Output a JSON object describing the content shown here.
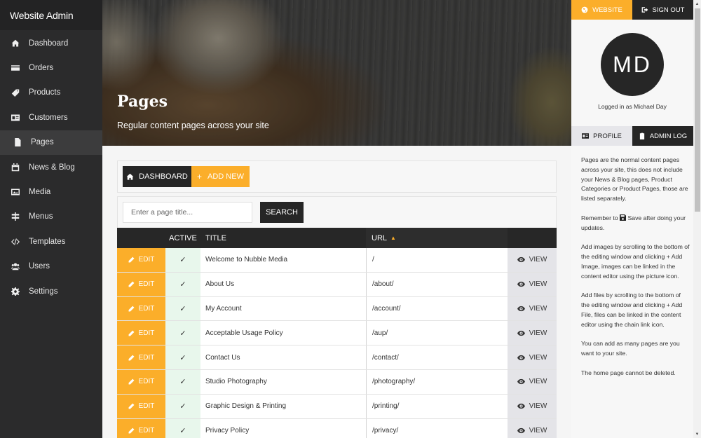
{
  "app": {
    "title": "Website Admin"
  },
  "sidebar": {
    "items": [
      {
        "label": "Dashboard",
        "icon": "home-icon",
        "active": false
      },
      {
        "label": "Orders",
        "icon": "credit-card-icon",
        "active": false
      },
      {
        "label": "Products",
        "icon": "tag-icon",
        "active": false
      },
      {
        "label": "Customers",
        "icon": "id-card-icon",
        "active": false
      },
      {
        "label": "Pages",
        "icon": "file-icon",
        "active": true
      },
      {
        "label": "News & Blog",
        "icon": "calendar-icon",
        "active": false
      },
      {
        "label": "Media",
        "icon": "image-icon",
        "active": false
      },
      {
        "label": "Menus",
        "icon": "signpost-icon",
        "active": false
      },
      {
        "label": "Templates",
        "icon": "code-icon",
        "active": false
      },
      {
        "label": "Users",
        "icon": "users-icon",
        "active": false
      },
      {
        "label": "Settings",
        "icon": "gear-icon",
        "active": false
      }
    ]
  },
  "hero": {
    "title": "Pages",
    "subtitle": "Regular content pages across your site"
  },
  "toolbar": {
    "dashboard_label": "DASHBOARD",
    "add_new_label": "ADD NEW"
  },
  "search": {
    "placeholder": "Enter a page title...",
    "value": "",
    "button_label": "SEARCH"
  },
  "table": {
    "columns": {
      "edit": "",
      "active": "ACTIVE",
      "title": "TITLE",
      "url": "URL",
      "view": ""
    },
    "sort": {
      "column": "url",
      "direction": "asc",
      "icon": "sort-up-icon"
    },
    "edit_label": "EDIT",
    "view_label": "VIEW",
    "active_mark": "✓",
    "rows": [
      {
        "active": true,
        "title": "Welcome to Nubble Media",
        "url": "/"
      },
      {
        "active": true,
        "title": "About Us",
        "url": "/about/"
      },
      {
        "active": true,
        "title": "My Account",
        "url": "/account/"
      },
      {
        "active": true,
        "title": "Acceptable Usage Policy",
        "url": "/aup/"
      },
      {
        "active": true,
        "title": "Contact Us",
        "url": "/contact/"
      },
      {
        "active": true,
        "title": "Studio Photography",
        "url": "/photography/"
      },
      {
        "active": true,
        "title": "Graphic Design & Printing",
        "url": "/printing/"
      },
      {
        "active": true,
        "title": "Privacy Policy",
        "url": "/privacy/"
      }
    ]
  },
  "right_panel": {
    "website_label": "WEBSITE",
    "sign_out_label": "SIGN OUT",
    "avatar_initials": "MD",
    "logged_in_text": "Logged in as Michael Day",
    "profile_label": "PROFILE",
    "admin_log_label": "ADMIN LOG",
    "help": {
      "p1": "Pages are the normal content pages across your site, this does not include your News & Blog pages, Product Categories or Product Pages, those are listed separately.",
      "p2_before": "Remember to ",
      "p2_after": " Save after doing your updates.",
      "p3_before": "Add images by scrolling to the bottom of the editing window and clicking ",
      "p3_after": " Add Image, images can be linked in the content editor using the picture icon.",
      "p4_before": "Add files by scrolling to the bottom of the editing window and clicking ",
      "p4_after": " Add File, files can be linked in the content editor using the chain link icon.",
      "p5": "You can add as many pages are you want to your site.",
      "p6": "The home page cannot be deleted."
    }
  },
  "colors": {
    "accent": "#fbae2a",
    "dark": "#262626",
    "sidebar_bg": "#2b2b2c",
    "active_cell_bg": "#e8f7ec",
    "view_cell_bg": "#e4e4e8"
  }
}
